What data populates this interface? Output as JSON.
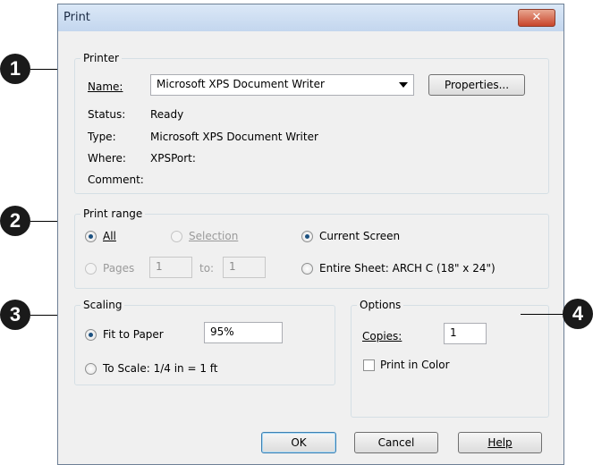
{
  "dialog": {
    "title": "Print",
    "close_glyph": "✕"
  },
  "printer": {
    "legend": "Printer",
    "name_label": "Name:",
    "name_value": "Microsoft XPS Document Writer",
    "properties_button": "Properties...",
    "status_label": "Status:",
    "status_value": "Ready",
    "type_label": "Type:",
    "type_value": "Microsoft XPS Document Writer",
    "where_label": "Where:",
    "where_value": "XPSPort:",
    "comment_label": "Comment:",
    "comment_value": ""
  },
  "print_range": {
    "legend": "Print range",
    "all_label": "All",
    "selection_label": "Selection",
    "current_screen_label": "Current Screen",
    "pages_label": "Pages",
    "pages_from": "1",
    "to_label": "to:",
    "pages_to": "1",
    "entire_sheet_label": "Entire Sheet: ARCH C  (18\" x 24\")"
  },
  "scaling": {
    "legend": "Scaling",
    "fit_to_paper_label": "Fit to Paper",
    "fit_percent": "95%",
    "to_scale_label": "To Scale: 1/4 in = 1 ft"
  },
  "options": {
    "legend": "Options",
    "copies_label": "Copies:",
    "copies_value": "1",
    "print_in_color_label": "Print in Color"
  },
  "buttons": {
    "ok": "OK",
    "cancel": "Cancel",
    "help": "Help"
  },
  "callouts": [
    "1",
    "2",
    "3",
    "4"
  ]
}
